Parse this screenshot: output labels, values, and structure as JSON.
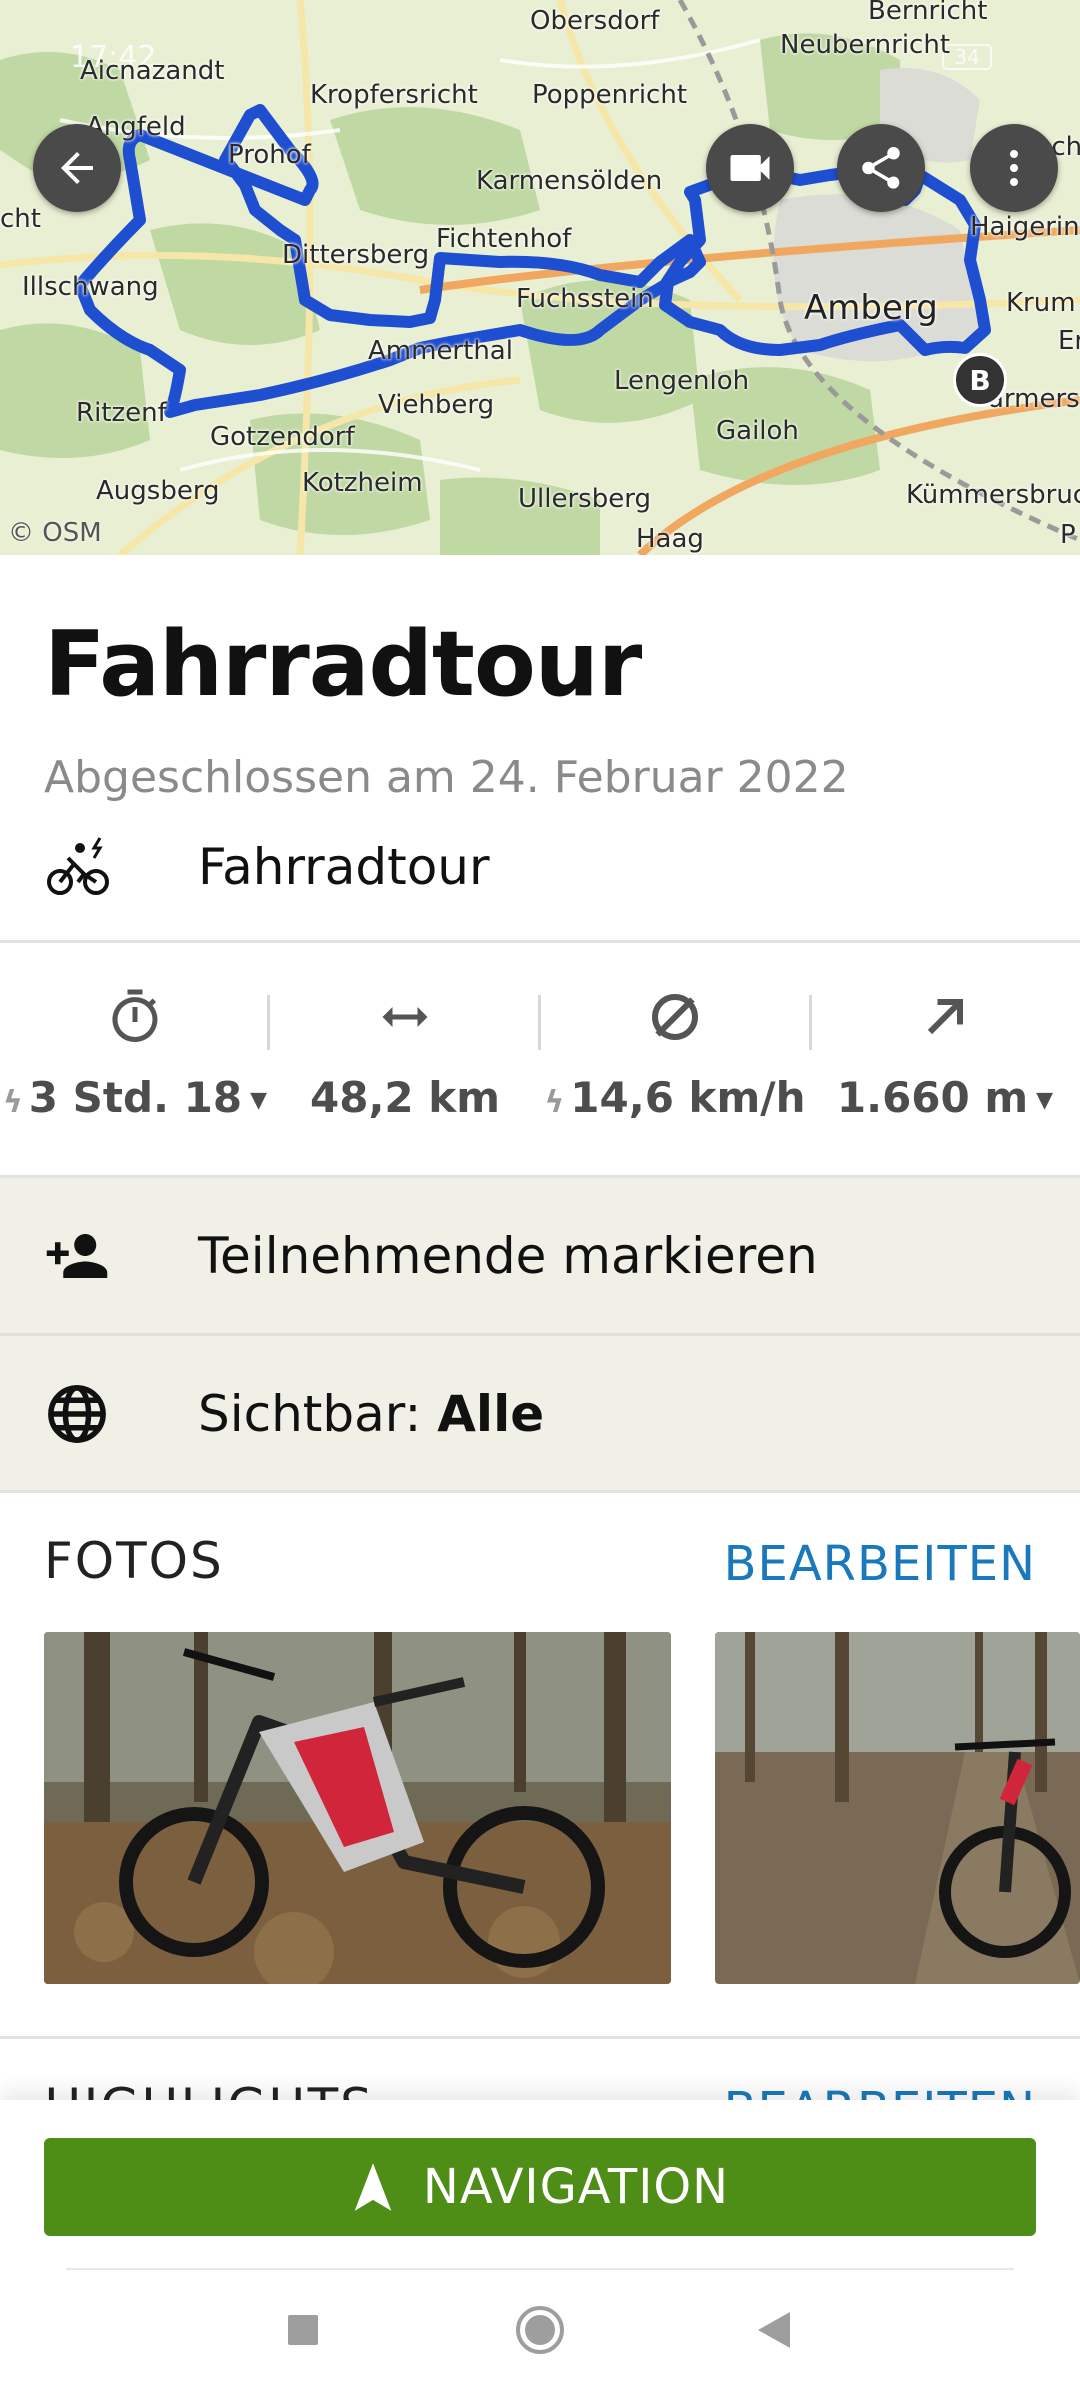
{
  "status_bar": {
    "time": "17:42",
    "battery": "34"
  },
  "map": {
    "attribution": "© OSM",
    "places": [
      "Obersdorf",
      "Bernricht",
      "Neubernricht",
      "Aicnazandt",
      "Kropfersricht",
      "Poppenricht",
      "Angfeld",
      "Prohof",
      "Karmensölden",
      "Ascha",
      "cht",
      "Haigering",
      "Dittersberg",
      "Fichtenhof",
      "Illschwang",
      "Fuchsstein",
      "Amberg",
      "Krum",
      "Er",
      "Ammerthal",
      "Lengenloh",
      "armersc",
      "Ritzenf",
      "Viehberg",
      "Gailoh",
      "Gotzendorf",
      "Augsberg",
      "Kotzheim",
      "Ullersberg",
      "Kümmersbruc",
      "Haag",
      "P"
    ],
    "end_marker": "B",
    "route_color": "#1f4fd1"
  },
  "controls": {
    "back_icon": "arrow-left-icon",
    "video_icon": "video-camera-icon",
    "share_icon": "share-icon",
    "more_icon": "more-vertical-icon"
  },
  "tour": {
    "title": "Fahrradtour",
    "completed": "Abgeschlossen am 24. Februar 2022",
    "sport_icon": "ebike-icon",
    "sport": "Fahrradtour"
  },
  "stats": [
    {
      "icon": "stopwatch-icon",
      "value": "3 Std. 18",
      "bolt": true,
      "caret": true
    },
    {
      "icon": "distance-icon",
      "value": "48,2 km",
      "bolt": false,
      "caret": false
    },
    {
      "icon": "average-icon",
      "value": "14,6 km/h",
      "bolt": true,
      "caret": false
    },
    {
      "icon": "ascent-icon",
      "value": "1.660 m",
      "bolt": false,
      "caret": true
    }
  ],
  "actions": {
    "tag_participants": "Teilnehmende markieren",
    "visibility_label": "Sichtbar:",
    "visibility_value": "Alle"
  },
  "photos": {
    "heading": "FOTOS",
    "edit": "BEARBEITEN"
  },
  "highlights": {
    "heading": "HIGHLIGHTS",
    "edit": "BEARBEITEN"
  },
  "navigation_button": "NAVIGATION",
  "colors": {
    "accent_green": "#4e8d16",
    "link_blue": "#1a79bd",
    "row_bg": "#f1f0e6"
  }
}
